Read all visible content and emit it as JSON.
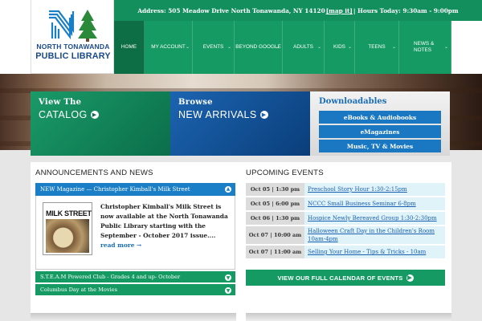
{
  "header": {
    "logo_small": "NORTH TONAWANDA",
    "logo_big": "PUBLIC LIBRARY",
    "address_prefix": "Address: 505 Meadow Drive North Tonawanda, NY 14120",
    "map_link": "[map it]",
    "hours_text": "| Hours Today: 9:30am - 9:00pm"
  },
  "nav": [
    {
      "label": "HOME",
      "width": 38
    },
    {
      "label": "MY ACCOUNT",
      "width": 60
    },
    {
      "label": "EVENTS",
      "width": 52
    },
    {
      "label": "BEYOND GOOGLE",
      "width": 60
    },
    {
      "label": "ADULTS",
      "width": 52
    },
    {
      "label": "KIDS",
      "width": 38
    },
    {
      "label": "TEENS",
      "width": 55
    },
    {
      "label": "NEWS & NOTES",
      "width": 65
    }
  ],
  "panels": {
    "catalog": {
      "title": "View The",
      "big": "CATALOG"
    },
    "arrivals": {
      "title": "Browse",
      "big": "NEW ARRIVALS"
    },
    "downloads": {
      "title": "Downloadables",
      "buttons": [
        "eBooks & Audiobooks",
        "eMagazines",
        "Music, TV & Movies"
      ]
    }
  },
  "announcements": {
    "title": "ANNOUNCEMENTS AND NEWS",
    "open_item": {
      "head": "NEW Magazine — Christopher Kimball's Milk Street",
      "mag_title": "MILK STREET",
      "text": "Christopher Kimball's Milk Street is now available at the North Tonawanda Public Library starting with the September - October 2017 issue....",
      "more": "read more →"
    },
    "items": [
      "S.T.E.A.M Powered Club - Grades 4 and up- October",
      "Columbus Day at the Movies"
    ]
  },
  "events": {
    "title": "UPCOMING EVENTS",
    "list": [
      {
        "date": "Oct 05 | 1:30 pm",
        "title": "Preschool Story Hour 1:30-2:15pm"
      },
      {
        "date": "Oct 05 | 6:00 pm",
        "title": "NCCC Small Business Seminar 6-8pm"
      },
      {
        "date": "Oct 06 | 1:30 pm",
        "title": "Hospice Newly Bereaved Group 1:30-2:30pm"
      },
      {
        "date": "Oct 07 | 10:00 am",
        "title": "Halloween Craft Day in the Children's Room 10am-4pm"
      },
      {
        "date": "Oct 07 | 11:00 am",
        "title": "Selling Your Home - Tips & Tricks - 10am"
      }
    ],
    "calendar_button": "VIEW OUR FULL CALENDAR OF EVENTS"
  },
  "colors": {
    "green": "#159a63",
    "blue": "#1a78c2",
    "dark_green": "#0d6e45"
  }
}
